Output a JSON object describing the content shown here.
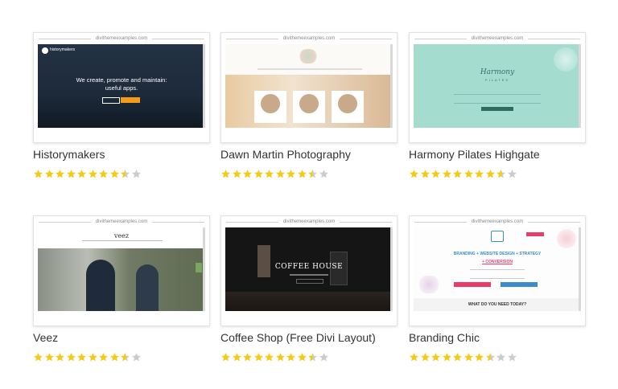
{
  "cards": [
    {
      "url": "divithemeexamples.com",
      "title": "Historymakers",
      "rating": 8.5,
      "preview": {
        "headline_1": "We create, promote and maintain:",
        "headline_2": "useful apps.",
        "logo_text": "historymakers"
      }
    },
    {
      "url": "divithemeexamples.com",
      "title": "Dawn Martin Photography",
      "rating": 8.5
    },
    {
      "url": "divithemeexamples.com",
      "title": "Harmony Pilates Highgate",
      "rating": 8.6,
      "preview": {
        "name": "Harmony",
        "subtitle": "PILATES"
      }
    },
    {
      "url": "divithemeexamples.com",
      "title": "Veez",
      "rating": 8.6,
      "preview": {
        "logo_text": "veez"
      }
    },
    {
      "url": "divithemeexamples.com",
      "title": "Coffee Shop (Free Divi Layout)",
      "rating": 8.5,
      "preview": {
        "headline": "COFFEE HOUSE"
      }
    },
    {
      "url": "divithemeexamples.com",
      "title": "Branding Chic",
      "rating": 7.5,
      "preview": {
        "headline_1": "BRANDING + WEBSITE DESIGN + STRATEGY",
        "headline_2": "+ CONVERSION",
        "footer": "WHAT DO YOU NEED TODAY?"
      }
    }
  ],
  "colors": {
    "star_filled": "#f3cb16",
    "star_empty": "#cccccc"
  }
}
